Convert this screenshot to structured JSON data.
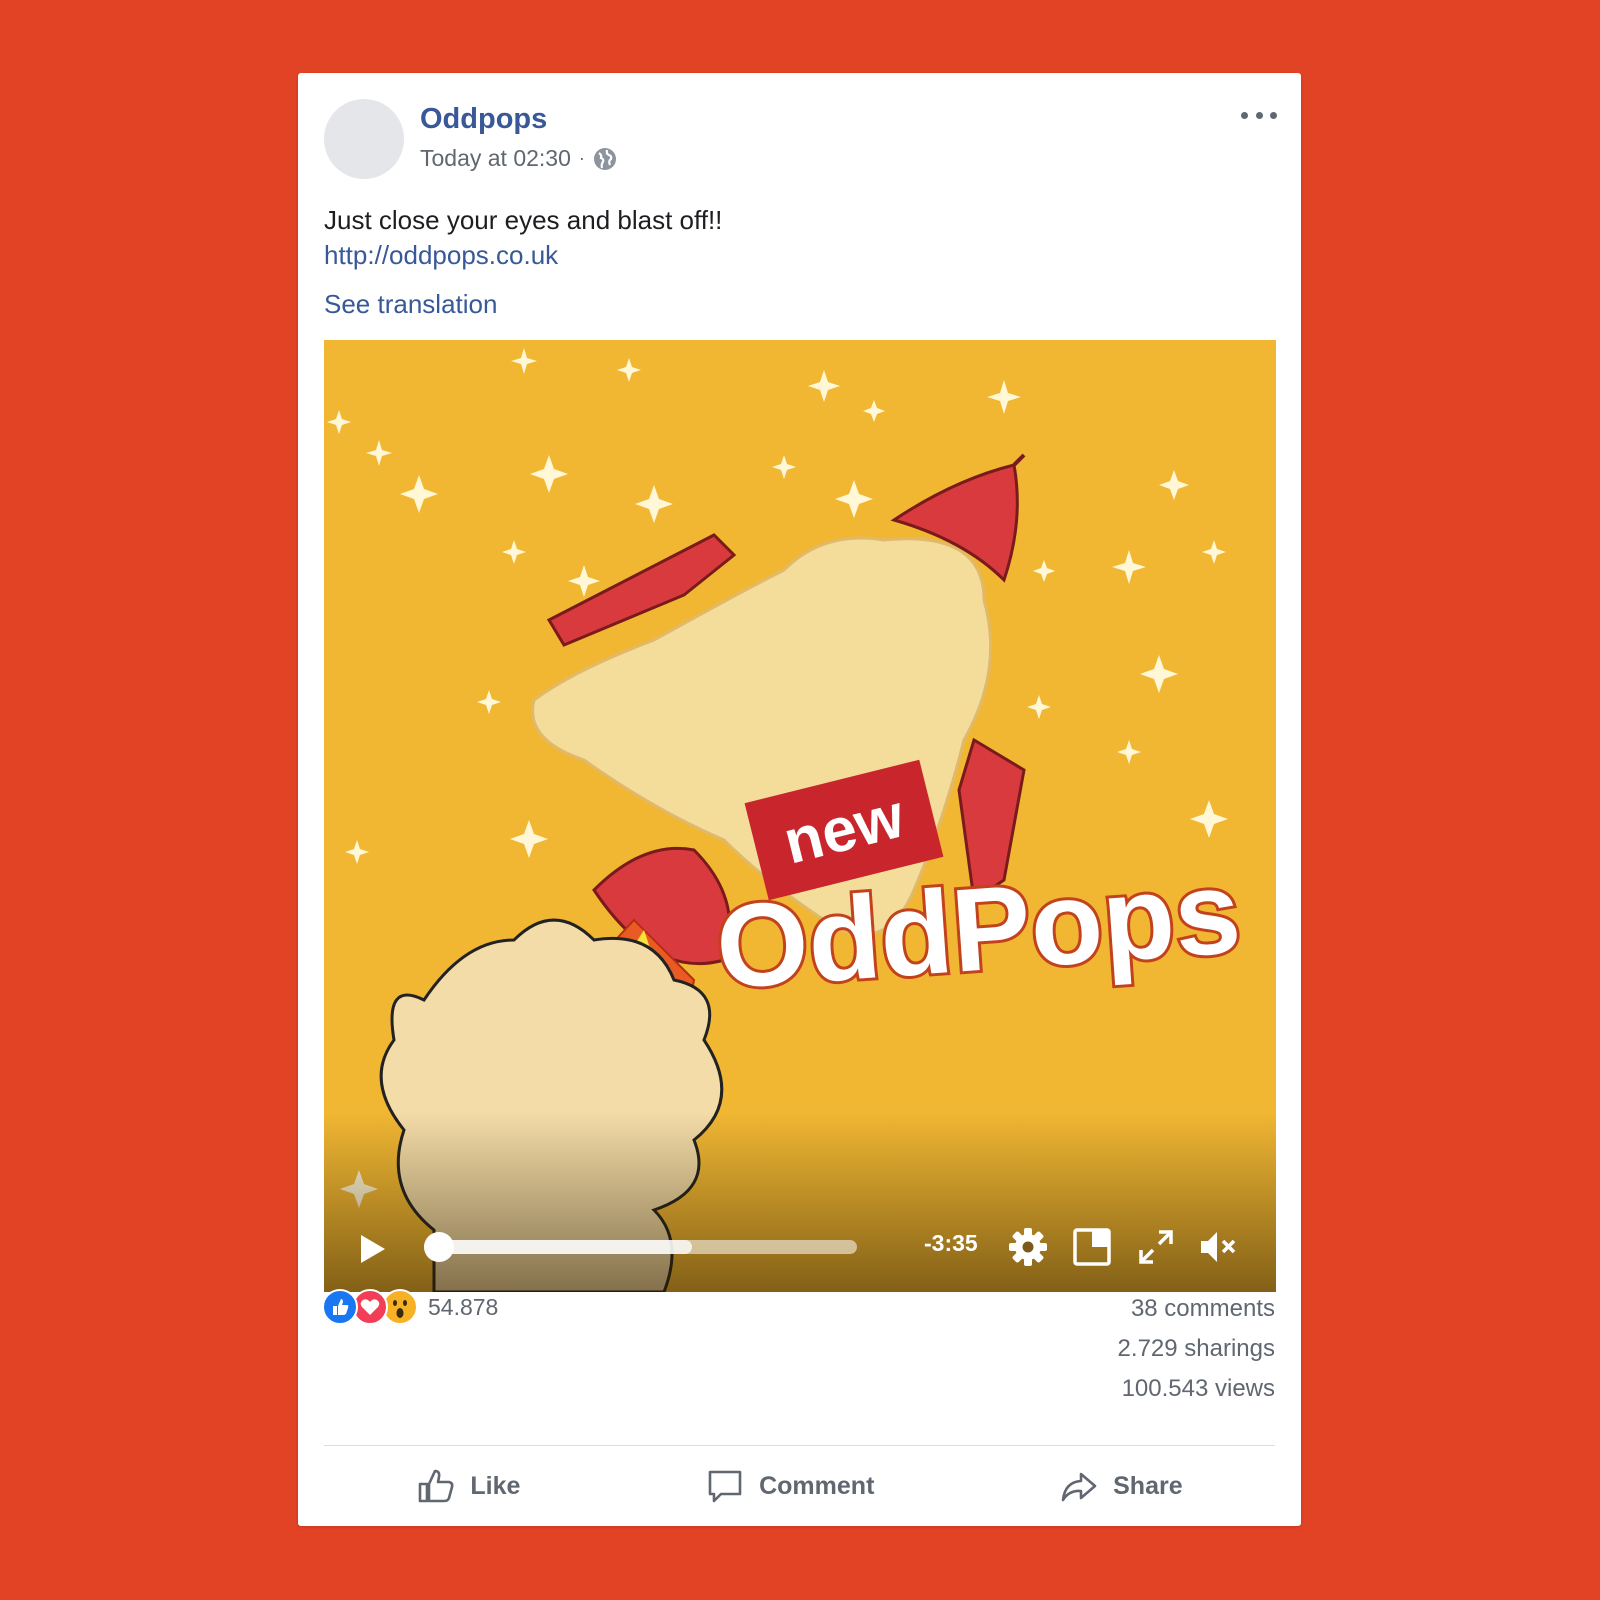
{
  "post": {
    "page_name": "Oddpops",
    "timestamp": "Today at 02:30",
    "separator": "·",
    "text": "Just close your eyes and blast off!!",
    "link": "http://oddpops.co.uk",
    "see_translation": "See translation"
  },
  "video": {
    "badge": "new",
    "logo_text": "OddPops",
    "time_remaining": "-3:35",
    "progress": 0.0,
    "buffered": 0.62,
    "muted": true
  },
  "stats": {
    "reactions": [
      "like",
      "love",
      "wow"
    ],
    "reaction_count": "54.878",
    "comments": "38 comments",
    "shares": "2.729 sharings",
    "views": "100.543 views"
  },
  "actions": {
    "like": "Like",
    "comment": "Comment",
    "share": "Share"
  },
  "colors": {
    "background": "#e34325",
    "link": "#385898",
    "video_bg": "#f1b733",
    "like": "#1877f2",
    "love": "#f33e58",
    "wow": "#f7b125"
  }
}
